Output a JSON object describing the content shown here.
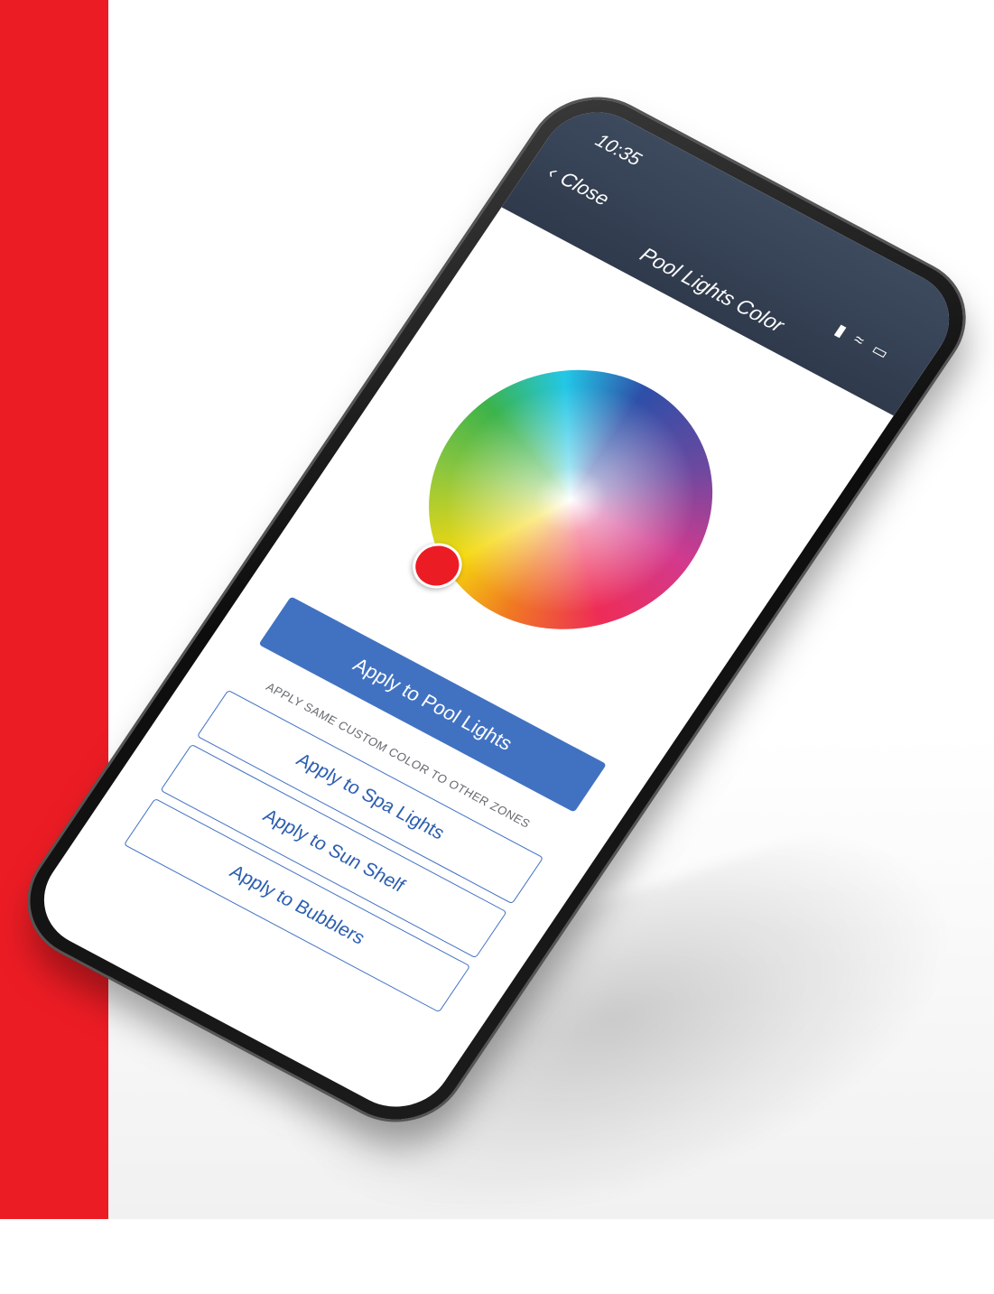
{
  "brand": {
    "accent": "#ec1c24",
    "header_bg": "#3d4a5e",
    "button_blue": "#4172c2"
  },
  "status_bar": {
    "time": "10:35",
    "icons": [
      "signal-icon",
      "wifi-icon",
      "battery-icon"
    ]
  },
  "header": {
    "back_label": "Close",
    "title": "Pool Lights Color"
  },
  "color_picker": {
    "selected_color": "#ec1c24"
  },
  "primary_action": {
    "label": "Apply to Pool Lights"
  },
  "zones_section": {
    "label": "APPLY SAME CUSTOM COLOR TO OTHER ZONES",
    "buttons": [
      {
        "label": "Apply to Spa Lights"
      },
      {
        "label": "Apply to Sun Shelf"
      },
      {
        "label": "Apply to Bubblers"
      }
    ]
  }
}
